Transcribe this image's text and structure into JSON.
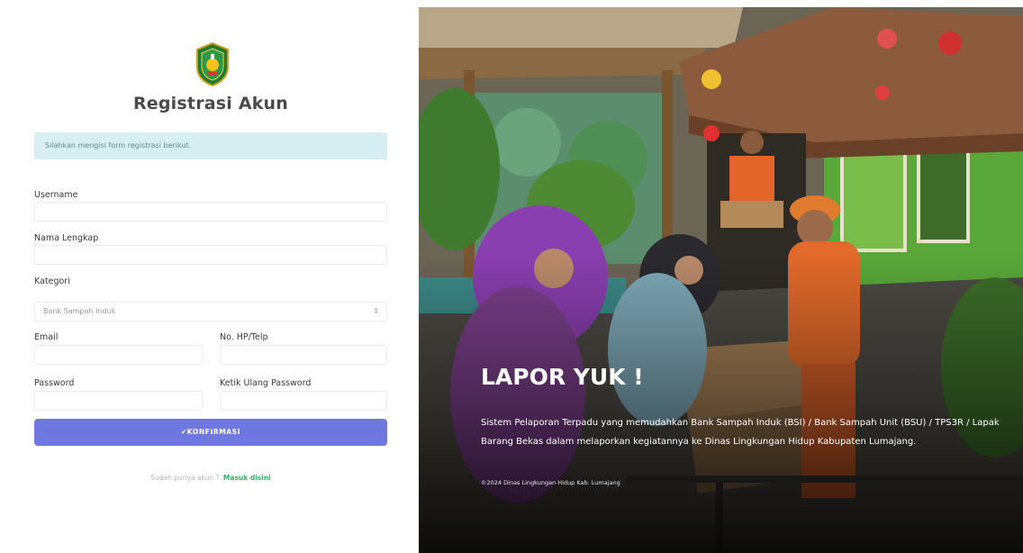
{
  "page": {
    "title": "Registrasi Akun",
    "alert": "Silahkan mengisi form registrasi berikut."
  },
  "form": {
    "username_label": "Username",
    "fullname_label": "Nama Lengkap",
    "category_label": "Kategori",
    "category_value": "Bank Sampah Induk",
    "email_label": "Email",
    "phone_label": "No. HP/Telp",
    "password_label": "Password",
    "password_confirm_label": "Ketik Ulang Password",
    "submit_label": "✔KONFIRMASI"
  },
  "login": {
    "prompt": "Sudah punya akun ?",
    "link": "Masuk disini"
  },
  "hero": {
    "title": "LAPOR YUK !",
    "description": "Sistem Pelaporan Terpadu yang memudahkan Bank Sampah Induk (BSI) / Bank Sampah Unit (BSU) / TPS3R / Lapak Barang Bekas dalam melaporkan kegiatannya ke Dinas Lingkungan Hidup Kabupaten Lumajang.",
    "copyright": "©2024 Dinas Lingkungan Hidup Kab. Lumajang"
  },
  "colors": {
    "primary_button": "#6f78e0",
    "alert_bg": "#d7eff2",
    "link": "#2fb163"
  },
  "icons": {
    "logo": "regency-emblem-icon",
    "select_arrow": "updown-arrow-icon"
  }
}
